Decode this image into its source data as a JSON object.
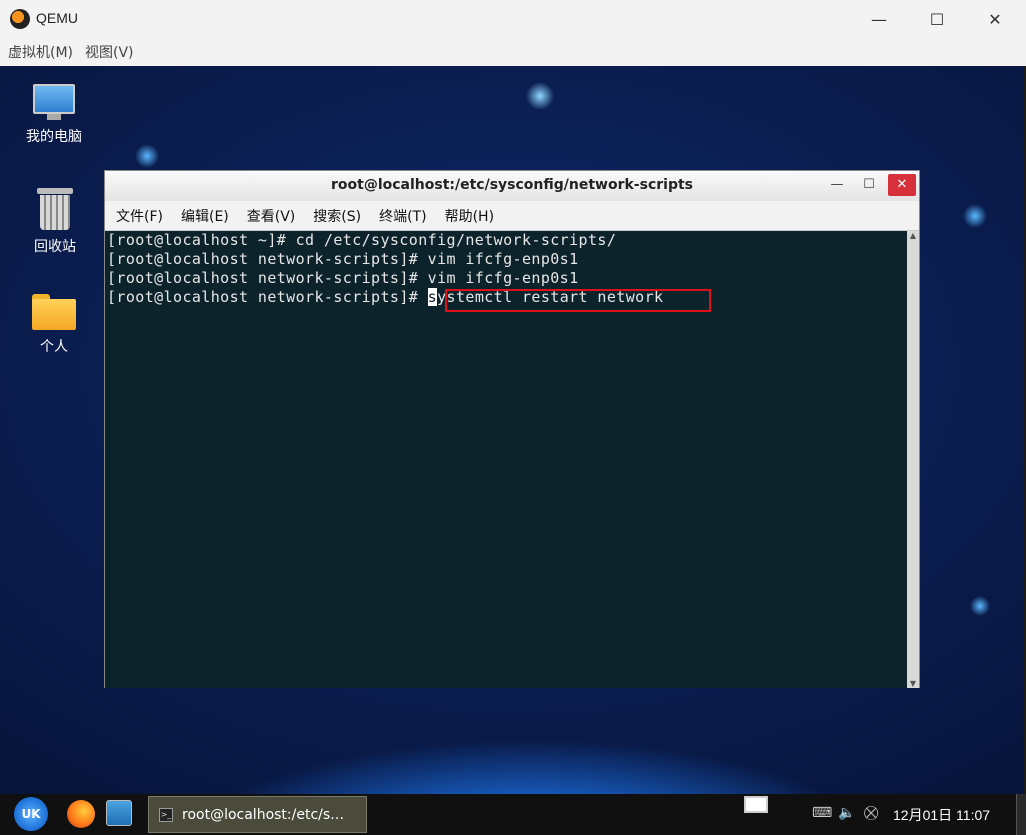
{
  "qemu": {
    "title": "QEMU",
    "menu": [
      "虚拟机(M)",
      "视图(V)"
    ],
    "controls": {
      "minimize": "—",
      "maximize": "☐",
      "close": "✕"
    }
  },
  "desktop": {
    "icons": [
      {
        "label": "我的电脑",
        "icon": "computer-icon"
      },
      {
        "label": "回收站",
        "icon": "trash-icon"
      },
      {
        "label": "个人",
        "icon": "home-folder-icon"
      }
    ]
  },
  "terminal": {
    "title": "root@localhost:/etc/sysconfig/network-scripts",
    "controls": {
      "minimize": "—",
      "maximize": "☐",
      "close": "✕"
    },
    "menu": [
      "文件(F)",
      "编辑(E)",
      "查看(V)",
      "搜索(S)",
      "终端(T)",
      "帮助(H)"
    ],
    "lines": [
      "[root@localhost ~]# cd /etc/sysconfig/network-scripts/",
      "[root@localhost network-scripts]# vim ifcfg-enp0s1",
      "[root@localhost network-scripts]# vim ifcfg-enp0s1"
    ],
    "current_prompt": "[root@localhost network-scripts]# ",
    "current_cmd_first": "s",
    "current_cmd_rest": "ystemctl restart network",
    "colors": {
      "background": "#0c232c",
      "highlight": "#e0101a"
    }
  },
  "taskbar": {
    "start_label": "UK",
    "task_label": "root@localhost:/etc/s…",
    "clock": "12月01日 11:07",
    "tray_icons": [
      "keyboard-icon",
      "volume-icon",
      "network-icon"
    ]
  }
}
